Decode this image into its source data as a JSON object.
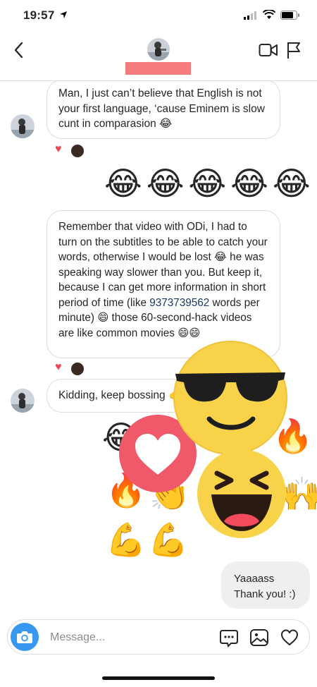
{
  "status_bar": {
    "time": "19:57"
  },
  "header": {
    "back_label": "Back"
  },
  "messages": {
    "m1": {
      "text": "Man, I just can’t believe that English is not your first language, ‘cause Eminem is slow cunt in comparasion 😂"
    },
    "m2": {
      "emojis": "😂😂😂😂😂"
    },
    "m3": {
      "text_before": "Remember that video with ODi, I had to turn on the subtitles to be able to catch your words, otherwise I would be lost 😂 he was speaking way slower than you. But keep it, because I can get more information in short period of time (like ",
      "link": "9373739562",
      "text_after": " words per minute) 😄 those 60-second-hack videos are like common movies 😄😄"
    },
    "m4": {
      "text": "Kidding, keep bossing 🤙"
    },
    "m6": {
      "line1": "Yaaaass",
      "line2": "Thank you! :)"
    }
  },
  "composer": {
    "placeholder": "Message..."
  },
  "colors": {
    "accent": "#3897f0",
    "heart": "#ed4956",
    "name_redaction": "#f47c7c",
    "outgoing_bubble": "#efefef"
  }
}
